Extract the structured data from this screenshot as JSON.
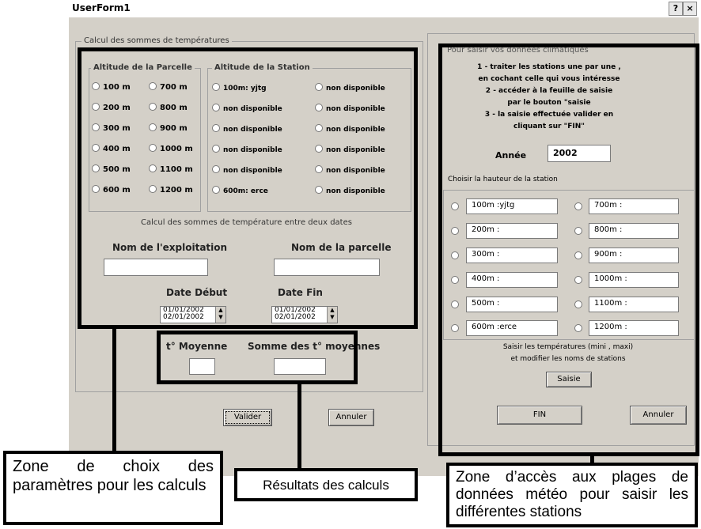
{
  "window": {
    "title": "UserForm1",
    "help_btn": "?",
    "close_btn": "×"
  },
  "left_frame": {
    "legend": "Calcul des sommes de températures"
  },
  "altitude_parcelle": {
    "label": "Altitude de la Parcelle",
    "col1": [
      "100 m",
      "200 m",
      "300 m",
      "400 m",
      "500 m",
      "600 m"
    ],
    "col2": [
      "700 m",
      "800 m",
      "900 m",
      "1000 m",
      "1100 m",
      "1200 m"
    ]
  },
  "altitude_station": {
    "label": "Altitude de la Station",
    "col1": [
      "100m: yjtg",
      "non disponible",
      "non disponible",
      "non disponible",
      "non disponible",
      "600m: erce"
    ],
    "col2": [
      "non disponible",
      "non disponible",
      "non disponible",
      "non disponible",
      "non disponible",
      "non disponible"
    ]
  },
  "calc": {
    "heading": "Calcul des sommes de température entre deux dates",
    "nom_exploitation": "Nom de l'exploitation",
    "nom_parcelle": "Nom de la parcelle",
    "date_debut": "Date Début",
    "date_fin": "Date Fin",
    "date_debut_values": [
      "01/01/2002",
      "02/01/2002"
    ],
    "date_fin_values": [
      "01/01/2002",
      "02/01/2002"
    ],
    "t_moyenne": "t° Moyenne",
    "somme_t": "Somme des t° moyennes"
  },
  "buttons": {
    "valider": "Valider",
    "annuler_left": "Annuler",
    "saisie": "Saisie",
    "fin": "FIN",
    "annuler_right": "Annuler"
  },
  "right_frame": {
    "legend": "Pour saisir vos données climatiques",
    "instructions": [
      "1 - traiter les stations une par une ,",
      "en cochant celle qui vous intéresse",
      "2 - accéder à la feuille de saisie",
      "par le bouton \"saisie",
      "3 - la saisie effectuée valider en",
      "cliquant sur \"FIN\""
    ],
    "annee_label": "Année",
    "annee_value": "2002",
    "choisir_label": "Choisir la hauteur de la station",
    "stations_left": [
      "100m :yjtg",
      "200m :",
      "300m :",
      "400m :",
      "500m :",
      "600m :erce"
    ],
    "stations_right": [
      "700m :",
      "800m :",
      "900m :",
      "1000m :",
      "1100m :",
      "1200m :"
    ],
    "saisir_text_1": "Saisir les températures (mini , maxi)",
    "saisir_text_2": "et modifier les noms de stations"
  },
  "callouts": {
    "zone_params": "Zone de choix des paramètres pour les calculs",
    "resultats": "Résultats des calculs",
    "zone_acces": "Zone d’accès aux plages de données météo pour saisir les différentes stations"
  }
}
